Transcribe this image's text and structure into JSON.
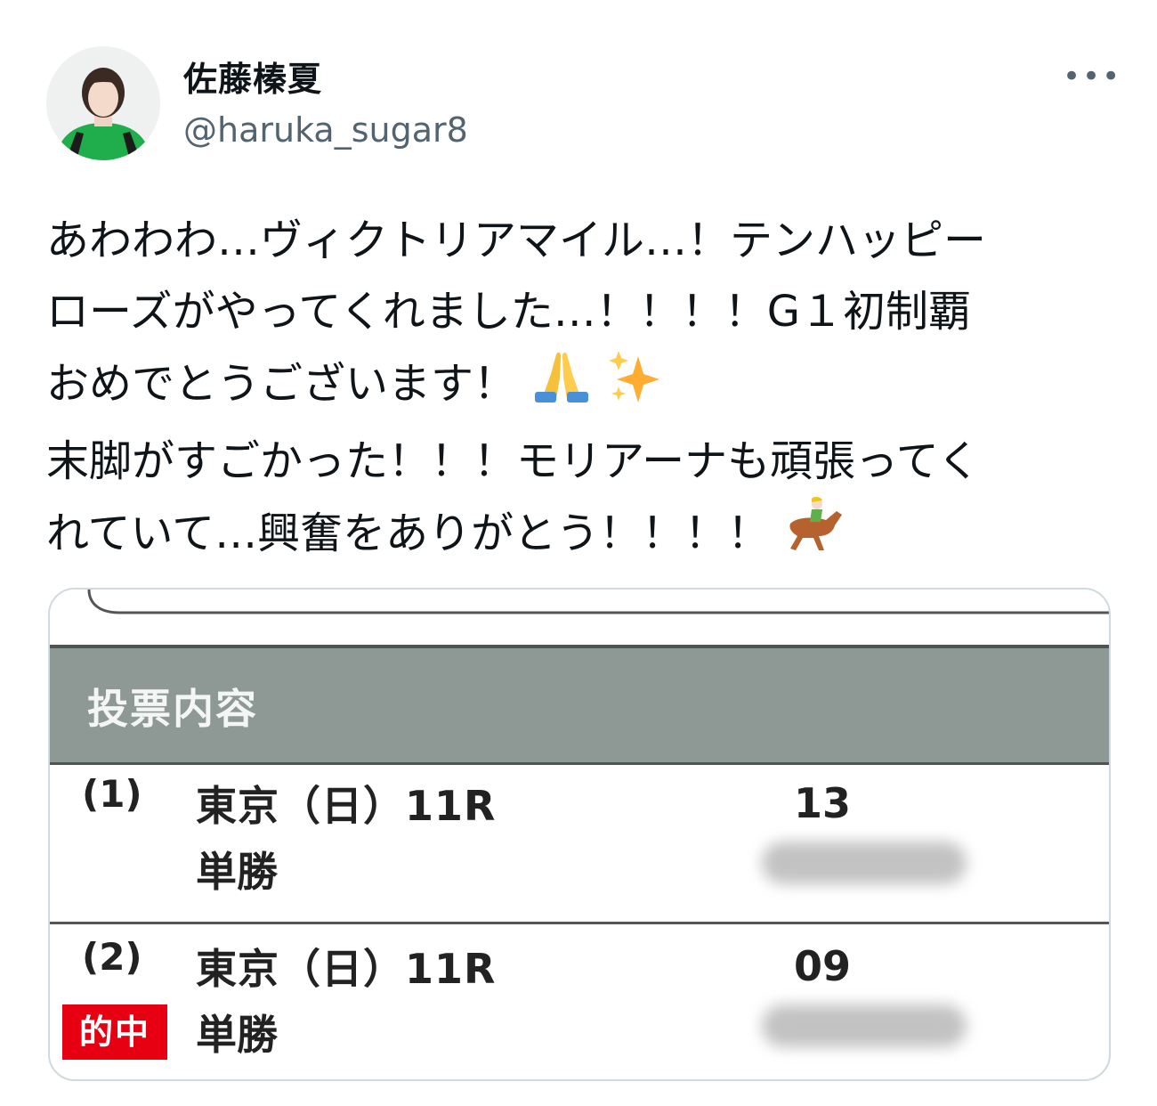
{
  "user": {
    "name": "佐藤榛夏",
    "handle": "@haruka_sugar8",
    "more_label": "•••"
  },
  "tweet": {
    "lines": [
      "あわわわ…ヴィクトリアマイル…！テンハッピー",
      "ローズがやってくれました…！！！！G１初制覇",
      "おめでとうございます！",
      "末脚がすごかった！！！モリアーナも頑張ってく",
      "れていて…興奮をありがとう！！！！"
    ],
    "emojis": [
      "folded-hands",
      "sparkles",
      "horse-racing"
    ]
  },
  "ticket": {
    "title": "投票内容",
    "rows": [
      {
        "num": "(1)",
        "venue": "東京（日）11R",
        "bet_type": "単勝",
        "horse": "13",
        "hit_label": ""
      },
      {
        "num": "(2)",
        "venue": "東京（日）11R",
        "bet_type": "単勝",
        "horse": "09",
        "hit_label": "的中"
      }
    ]
  },
  "colors": {
    "band": "#8e9894",
    "hit": "#e60012",
    "avatar_outfit": "#1fae4b"
  }
}
